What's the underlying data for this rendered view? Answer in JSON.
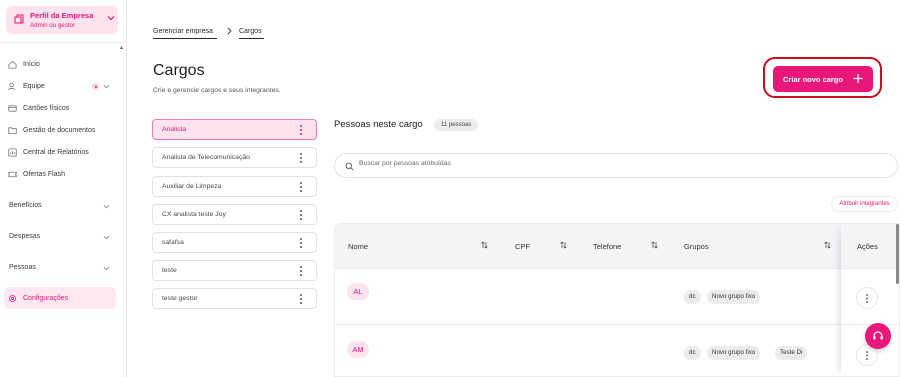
{
  "sidebar": {
    "profile": {
      "title": "Perfil da Empresa",
      "subtitle": "Admin ou gestor"
    },
    "items": [
      {
        "label": "Início",
        "icon": "home-icon"
      },
      {
        "label": "Equipe",
        "icon": "users-icon"
      },
      {
        "label": "Cartões físicos",
        "icon": "card-icon"
      },
      {
        "label": "Gestão de documentos",
        "icon": "folder-icon"
      },
      {
        "label": "Central de Relatórios",
        "icon": "report-icon"
      },
      {
        "label": "Ofertas Flash",
        "icon": "ticket-icon"
      }
    ],
    "sections": [
      {
        "label": "Benefícios"
      },
      {
        "label": "Despesas"
      },
      {
        "label": "Pessoas"
      }
    ],
    "active": {
      "label": "Configurações",
      "icon": "gear-icon"
    }
  },
  "breadcrumb": {
    "parent": "Gerenciar empresa",
    "current": "Cargos"
  },
  "page": {
    "title": "Cargos",
    "subtitle": "Crie e gerencie cargos e seus integrantes.",
    "create_button": "Criar novo cargo"
  },
  "roles": [
    {
      "label": "Analista",
      "selected": true
    },
    {
      "label": "Analista de Telecomunicação"
    },
    {
      "label": "Auxiliar de Limpeza"
    },
    {
      "label": "CX analista teste Joy"
    },
    {
      "label": "safafsa"
    },
    {
      "label": "teste"
    },
    {
      "label": "teste gestor"
    }
  ],
  "people": {
    "heading": "Pessoas neste cargo",
    "count": "11 pessoas",
    "search_placeholder": "Buscar por pessoas atribuídas",
    "assign_button": "Atribuir integrantes"
  },
  "table": {
    "columns": [
      "Nome",
      "CPF",
      "Telefone",
      "Grupos",
      "Ações"
    ],
    "rows": [
      {
        "initials": "AL",
        "groups": [
          "dc",
          "Novo grupo fixo"
        ]
      },
      {
        "initials": "AM",
        "groups": [
          "dc",
          "Novo grupo fixo",
          "Teste Di"
        ]
      }
    ]
  },
  "colors": {
    "accent": "#e8187b",
    "accent_soft": "#fde3ee",
    "highlight_ring": "#c40f1f"
  }
}
